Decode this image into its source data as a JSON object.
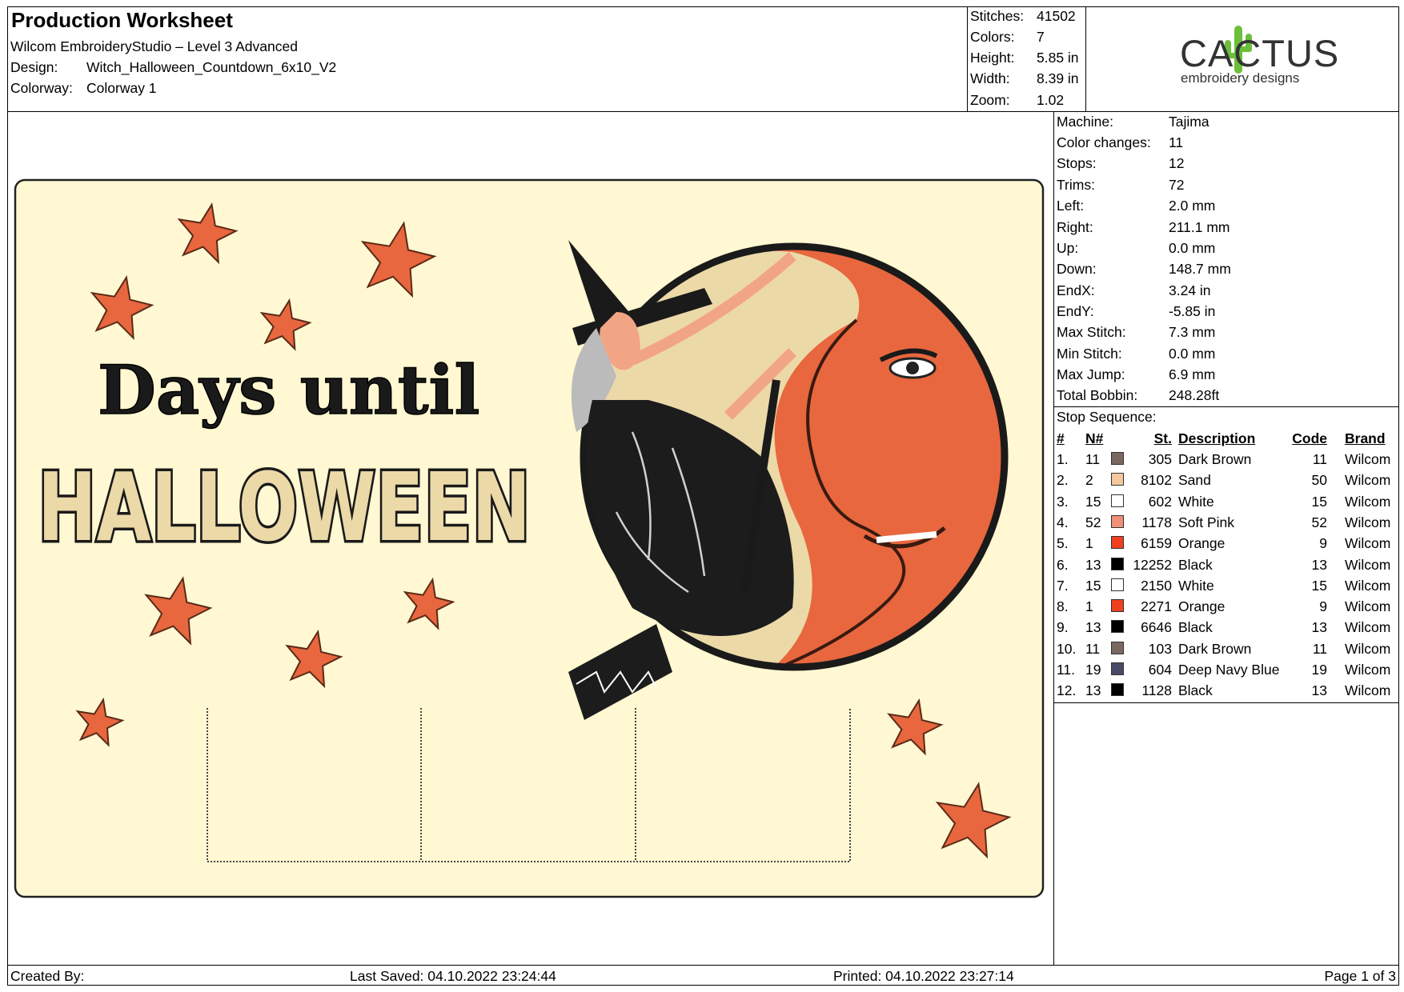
{
  "header": {
    "title": "Production Worksheet",
    "software": "Wilcom EmbroideryStudio – Level 3 Advanced",
    "design_label": "Design:",
    "design_value": "Witch_Halloween_Countdown_6x10_V2",
    "colorway_label": "Colorway:",
    "colorway_value": "Colorway 1"
  },
  "summary": [
    {
      "label": "Stitches:",
      "value": "41502"
    },
    {
      "label": "Colors:",
      "value": "7"
    },
    {
      "label": "Height:",
      "value": "5.85 in"
    },
    {
      "label": "Width:",
      "value": "8.39 in"
    },
    {
      "label": "Zoom:",
      "value": "1.02"
    }
  ],
  "logo": {
    "name": "CACTUS",
    "tagline": "embroidery designs"
  },
  "machine_info": [
    {
      "label": "Machine:",
      "value": "Tajima"
    },
    {
      "label": "Color changes:",
      "value": "11"
    },
    {
      "label": "Stops:",
      "value": "12"
    },
    {
      "label": "Trims:",
      "value": "72"
    },
    {
      "label": "Left:",
      "value": "2.0 mm"
    },
    {
      "label": "Right:",
      "value": "211.1 mm"
    },
    {
      "label": "Up:",
      "value": "0.0 mm"
    },
    {
      "label": "Down:",
      "value": "148.7 mm"
    },
    {
      "label": "EndX:",
      "value": "3.24 in"
    },
    {
      "label": "EndY:",
      "value": "-5.85 in"
    },
    {
      "label": "Max Stitch:",
      "value": "7.3 mm"
    },
    {
      "label": "Min Stitch:",
      "value": "0.0 mm"
    },
    {
      "label": "Max Jump:",
      "value": "6.9 mm"
    },
    {
      "label": "Total Bobbin:",
      "value": "248.28ft"
    }
  ],
  "stop_sequence": {
    "title": "Stop Sequence:",
    "columns": [
      "#",
      "N#",
      "St.",
      "Description",
      "Code",
      "Brand"
    ],
    "rows": [
      {
        "idx": "1.",
        "n": "11",
        "color": "#7a6860",
        "st": "305",
        "desc": "Dark Brown",
        "code": "11",
        "brand": "Wilcom"
      },
      {
        "idx": "2.",
        "n": "2",
        "color": "#f5c79e",
        "st": "8102",
        "desc": "Sand",
        "code": "50",
        "brand": "Wilcom"
      },
      {
        "idx": "3.",
        "n": "15",
        "color": "#ffffff",
        "st": "602",
        "desc": "White",
        "code": "15",
        "brand": "Wilcom"
      },
      {
        "idx": "4.",
        "n": "52",
        "color": "#f09078",
        "st": "1178",
        "desc": "Soft Pink",
        "code": "52",
        "brand": "Wilcom"
      },
      {
        "idx": "5.",
        "n": "1",
        "color": "#f04020",
        "st": "6159",
        "desc": "Orange",
        "code": "9",
        "brand": "Wilcom"
      },
      {
        "idx": "6.",
        "n": "13",
        "color": "#000000",
        "st": "12252",
        "desc": "Black",
        "code": "13",
        "brand": "Wilcom"
      },
      {
        "idx": "7.",
        "n": "15",
        "color": "#ffffff",
        "st": "2150",
        "desc": "White",
        "code": "15",
        "brand": "Wilcom"
      },
      {
        "idx": "8.",
        "n": "1",
        "color": "#f04020",
        "st": "2271",
        "desc": "Orange",
        "code": "9",
        "brand": "Wilcom"
      },
      {
        "idx": "9.",
        "n": "13",
        "color": "#000000",
        "st": "6646",
        "desc": "Black",
        "code": "13",
        "brand": "Wilcom"
      },
      {
        "idx": "10.",
        "n": "11",
        "color": "#7a6860",
        "st": "103",
        "desc": "Dark Brown",
        "code": "11",
        "brand": "Wilcom"
      },
      {
        "idx": "11.",
        "n": "19",
        "color": "#4a4a66",
        "st": "604",
        "desc": "Deep Navy Blue",
        "code": "19",
        "brand": "Wilcom"
      },
      {
        "idx": "12.",
        "n": "13",
        "color": "#000000",
        "st": "1128",
        "desc": "Black",
        "code": "13",
        "brand": "Wilcom"
      }
    ]
  },
  "design_preview": {
    "line1": "Days until",
    "line2": "HALLOWEEN",
    "background_color": "#fff8d2",
    "star_color": "#e8673e",
    "moon_color": "#e8673e",
    "sand_color": "#ecd9a8"
  },
  "footer": {
    "created_by": "Created By:",
    "last_saved": "Last Saved: 04.10.2022 23:24:44",
    "printed": "Printed: 04.10.2022 23:27:14",
    "page": "Page 1 of 3"
  }
}
